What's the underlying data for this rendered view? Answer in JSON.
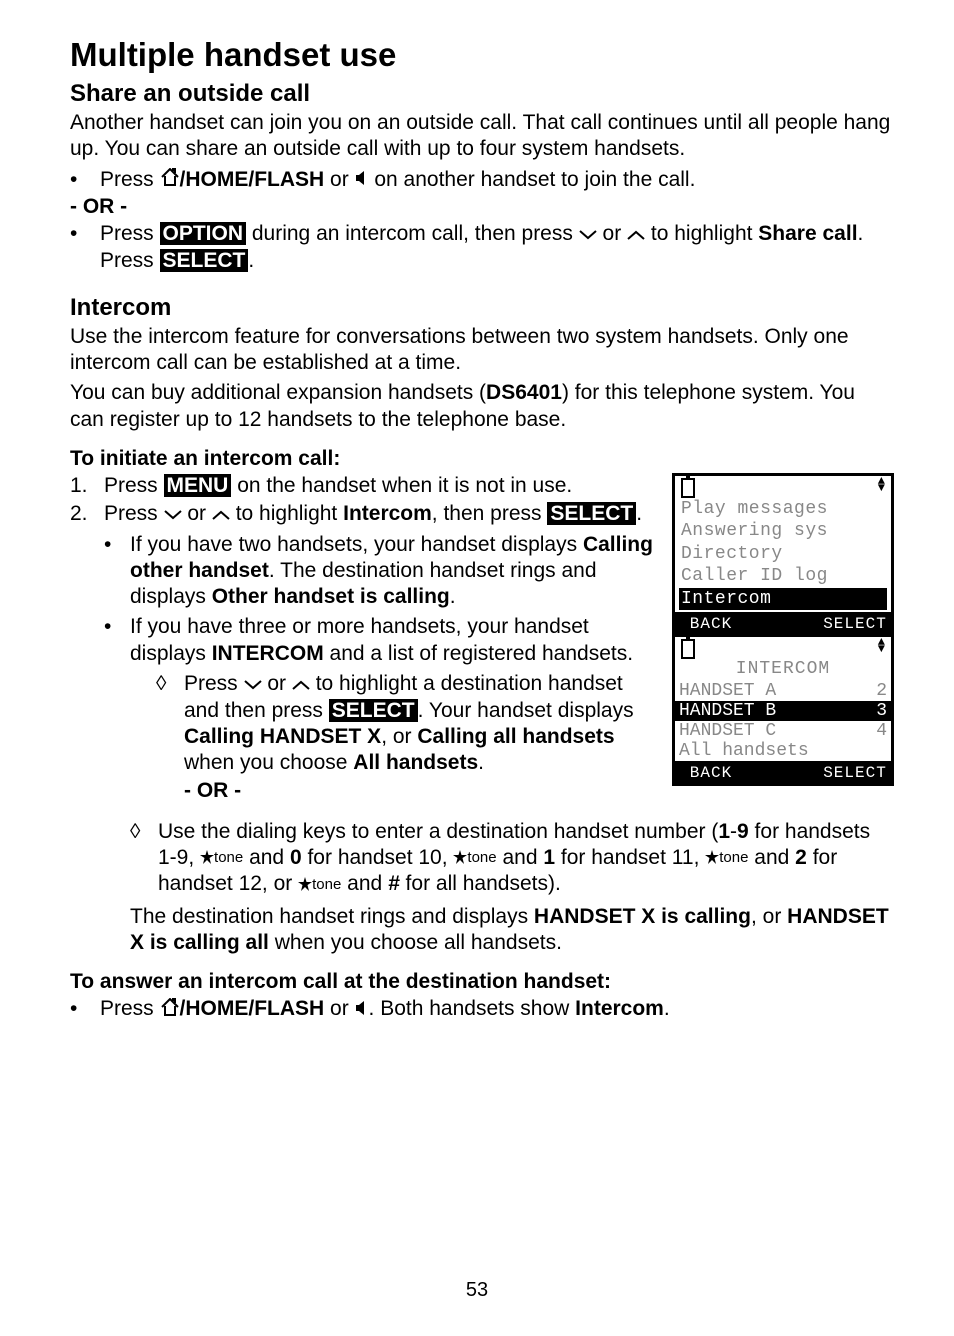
{
  "page_title": "Multiple handset use",
  "section1": {
    "header": "Share an outside call",
    "para": "Another handset can join you on an outside call. That call continues until all people hang up. You can share an outside call with up to four system handsets.",
    "bullet1_a": "Press ",
    "bullet1_home": "/HOME/",
    "bullet1_flash": "FLASH",
    "bullet1_b": " or ",
    "bullet1_c": " on another handset to join the call.",
    "or": "- OR -",
    "bullet2_a": "Press ",
    "bullet2_option": "OPTION",
    "bullet2_b": " during an intercom call, then press ",
    "bullet2_c": " or ",
    "bullet2_d": " to highlight ",
    "bullet2_share": "Share call",
    "bullet2_e": ". Press ",
    "bullet2_select": "SELECT",
    "bullet2_f": "."
  },
  "section2": {
    "header": "Intercom",
    "para1": "Use the intercom feature for conversations between two system handsets. Only one intercom call can be established at a time.",
    "para2_a": "You can buy additional expansion handsets (",
    "para2_model": "DS6401",
    "para2_b": ") for this telephone system. You can register up to 12 handsets to the telephone base.",
    "sub1": "To initiate an intercom call:",
    "step1_a": "Press ",
    "step1_menu": "MENU",
    "step1_b": " on the handset when it is not in use.",
    "step2_a": "Press ",
    "step2_b": " or ",
    "step2_c": " to highlight ",
    "step2_intercom": "Intercom",
    "step2_d": ", then press ",
    "step2_select": "SELECT",
    "step2_e": ".",
    "step2_sub1_a": "If you have two handsets, your handset displays ",
    "step2_sub1_b": "Calling other handset",
    "step2_sub1_c": ". The destination handset rings and displays ",
    "step2_sub1_d": "Other handset is calling",
    "step2_sub1_e": ".",
    "step2_sub2_a": "If you have three or more handsets, your handset displays ",
    "step2_sub2_b": "INTERCOM",
    "step2_sub2_c": " and a list of registered handsets.",
    "dia1_a": "Press ",
    "dia1_b": " or ",
    "dia1_c": " to highlight a destination handset and then press ",
    "dia1_select": "SELECT",
    "dia1_d": ". Your handset displays ",
    "dia1_e": "Calling HANDSET X",
    "dia1_f": ", or ",
    "dia1_g": "Calling all handsets",
    "dia1_h": " when you choose ",
    "dia1_i": "All handsets",
    "dia1_j": ".",
    "dia_or": "- OR -",
    "dia2_a": "Use the dialing keys to enter a destination handset number (",
    "dia2_b": "1",
    "dia2_c": "-",
    "dia2_d": "9",
    "dia2_e": " for handsets 1-9, ",
    "dia2_f": " and ",
    "dia2_g": "0",
    "dia2_h": " for handset 10, ",
    "dia2_i": " and ",
    "dia2_j": "1",
    "dia2_k": " for handset 11, ",
    "dia2_l": " and ",
    "dia2_m": "2",
    "dia2_n": " for handset 12, or ",
    "dia2_o": " and ",
    "dia2_p": "#",
    "dia2_q": " for all handsets).",
    "dest_a": "The destination handset rings and displays ",
    "dest_b": "HANDSET X is calling",
    "dest_c": ", or ",
    "dest_d": "HANDSET X is calling all",
    "dest_e": " when you choose all handsets.",
    "sub2": "To answer an intercom call at the destination handset:",
    "ans_a": "Press ",
    "ans_home": "/HOME/",
    "ans_flash": "FLASH",
    "ans_b": " or ",
    "ans_c": ". Both handsets show ",
    "ans_d": "Intercom",
    "ans_e": "."
  },
  "lcd1": {
    "l1": "Play messages",
    "l2": "Answering sys",
    "l3": "Directory",
    "l4": "Caller ID log",
    "l5": "Intercom",
    "back": "BACK",
    "select": "SELECT"
  },
  "lcd2": {
    "title": "INTERCOM",
    "r1a": "HANDSET A",
    "r1b": "2",
    "r2a": "HANDSET B",
    "r2b": "3",
    "r3a": "HANDSET C",
    "r3b": "4",
    "r4": "All handsets",
    "back": "BACK",
    "select": "SELECT"
  },
  "page_number": "53",
  "icons": {
    "tone": "tone"
  }
}
